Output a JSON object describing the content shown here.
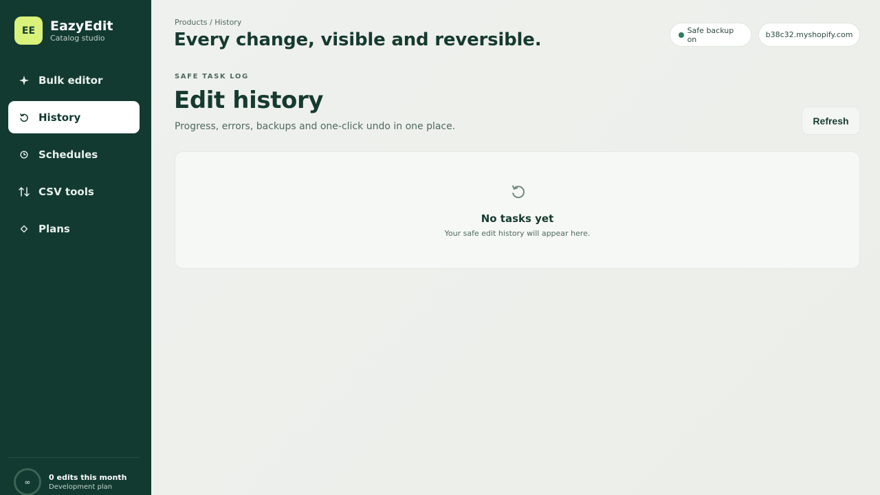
{
  "brand": {
    "logo": "EE",
    "name": "EazyEdit",
    "subtitle": "Catalog studio"
  },
  "sidebar": {
    "items": [
      {
        "label": "Bulk editor",
        "icon": "sparkle-icon",
        "active": false
      },
      {
        "label": "History",
        "icon": "history-icon",
        "active": true
      },
      {
        "label": "Schedules",
        "icon": "clock-icon",
        "active": false
      },
      {
        "label": "CSV tools",
        "icon": "arrows-updown-icon",
        "active": false
      },
      {
        "label": "Plans",
        "icon": "diamond-icon",
        "active": false
      }
    ],
    "usage": {
      "ring_symbol": "∞",
      "title": "0 edits this month",
      "subtitle": "Development plan"
    }
  },
  "header": {
    "breadcrumb": "Products / History",
    "title": "Every change, visible and reversible.",
    "backup_status": "Safe backup on",
    "store": "b38c32.myshopify.com"
  },
  "section": {
    "eyebrow": "SAFE TASK LOG",
    "title": "Edit history",
    "subtitle": "Progress, errors, backups and one-click undo in one place.",
    "refresh_label": "Refresh"
  },
  "empty_state": {
    "icon": "history-icon",
    "title": "No tasks yet",
    "subtitle": "Your safe edit history will appear here."
  },
  "colors": {
    "sidebar": "#123a31",
    "accent": "#d9f27a",
    "status": "#2e7d5b"
  }
}
